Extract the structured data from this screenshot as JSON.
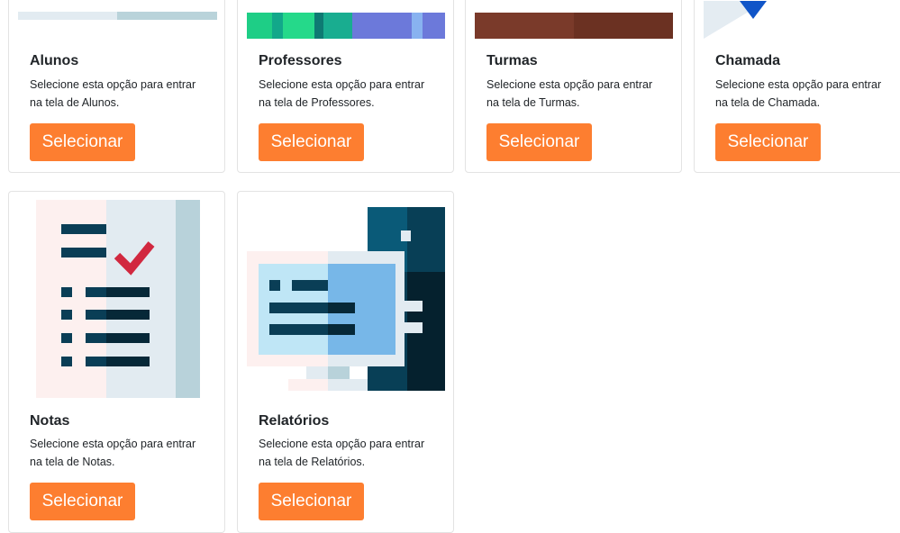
{
  "cards": [
    {
      "title": "Alunos",
      "text": "Selecione esta opção para entrar na tela de Alunos.",
      "button": "Selecionar",
      "image_icon": "students-illustration"
    },
    {
      "title": "Professores",
      "text": "Selecione esta opção para entrar na tela de Professores.",
      "button": "Selecionar",
      "image_icon": "teachers-illustration"
    },
    {
      "title": "Turmas",
      "text": "Selecione esta opção para entrar na tela de Turmas.",
      "button": "Selecionar",
      "image_icon": "classes-illustration"
    },
    {
      "title": "Chamada",
      "text": "Selecione esta opção para entrar na tela de Chamada.",
      "button": "Selecionar",
      "image_icon": "attendance-illustration"
    },
    {
      "title": "Notas",
      "text": "Selecione esta opção para entrar na tela de Notas.",
      "button": "Selecionar",
      "image_icon": "grades-checklist-icon"
    },
    {
      "title": "Relatórios",
      "text": "Selecione esta opção para entrar na tela de Relatórios.",
      "button": "Selecionar",
      "image_icon": "reports-computer-icon"
    }
  ],
  "colors": {
    "button": "#fd7e30",
    "button_text": "#ffffff",
    "card_border": "#e3e3e3"
  }
}
